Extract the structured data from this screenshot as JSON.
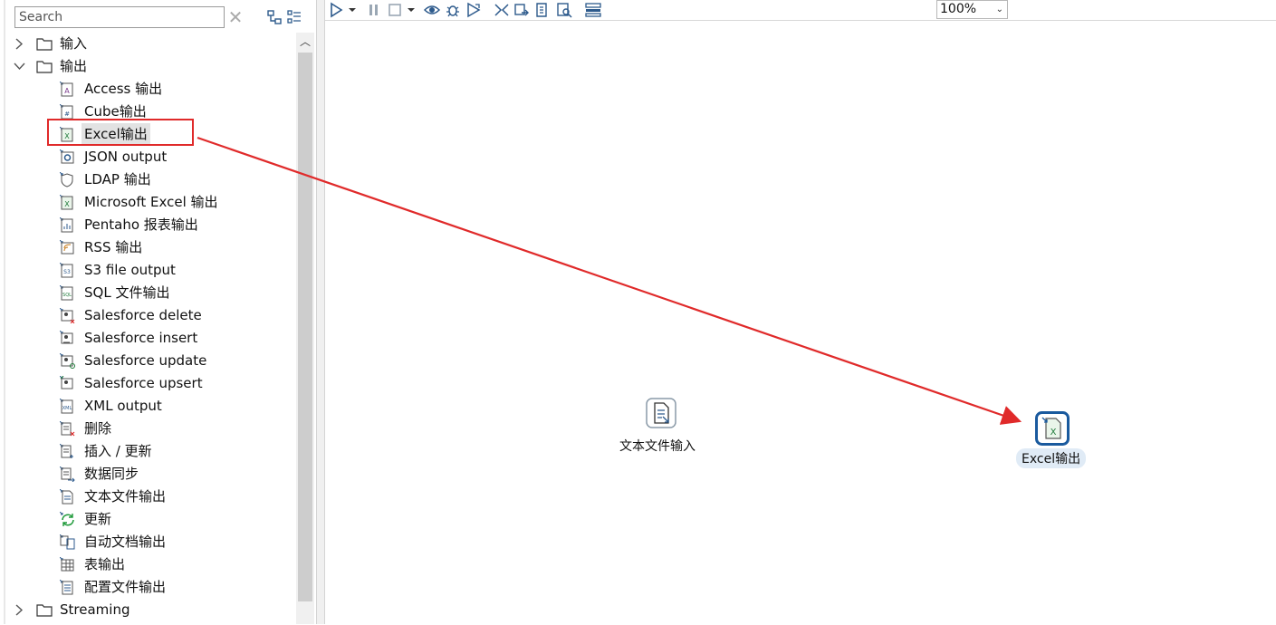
{
  "search": {
    "placeholder": "Search",
    "value": ""
  },
  "tree": {
    "categories": [
      {
        "label": "输入",
        "expanded": false
      },
      {
        "label": "输出",
        "expanded": true
      },
      {
        "label": "Streaming",
        "expanded": false
      }
    ],
    "items": [
      {
        "label": "Access 输出",
        "icon": "access-icon"
      },
      {
        "label": "Cube输出",
        "icon": "cube-icon"
      },
      {
        "label": "Excel输出",
        "icon": "excel-icon",
        "selected": true
      },
      {
        "label": "JSON output",
        "icon": "json-icon"
      },
      {
        "label": "LDAP 输出",
        "icon": "ldap-icon"
      },
      {
        "label": "Microsoft Excel 输出",
        "icon": "excel-icon"
      },
      {
        "label": "Pentaho 报表输出",
        "icon": "report-icon"
      },
      {
        "label": "RSS 输出",
        "icon": "rss-icon"
      },
      {
        "label": "S3 file output",
        "icon": "s3-icon"
      },
      {
        "label": "SQL 文件输出",
        "icon": "sql-icon"
      },
      {
        "label": "Salesforce delete",
        "icon": "salesforce-delete-icon"
      },
      {
        "label": "Salesforce insert",
        "icon": "salesforce-insert-icon"
      },
      {
        "label": "Salesforce update",
        "icon": "salesforce-update-icon"
      },
      {
        "label": "Salesforce upsert",
        "icon": "salesforce-upsert-icon"
      },
      {
        "label": "XML output",
        "icon": "xml-icon"
      },
      {
        "label": "删除",
        "icon": "delete-icon"
      },
      {
        "label": "插入 / 更新",
        "icon": "insert-update-icon"
      },
      {
        "label": "数据同步",
        "icon": "sync-icon"
      },
      {
        "label": "文本文件输出",
        "icon": "text-file-icon"
      },
      {
        "label": "更新",
        "icon": "update-icon"
      },
      {
        "label": "自动文档输出",
        "icon": "autodoc-icon"
      },
      {
        "label": "表输出",
        "icon": "table-icon"
      },
      {
        "label": "配置文件输出",
        "icon": "properties-icon"
      }
    ]
  },
  "toolbar": {
    "zoom": "100%",
    "zoom_dropdown": "⌄",
    "clear": "✕"
  },
  "canvas": {
    "steps": [
      {
        "label": "文本文件输入",
        "icon": "text-file-input-icon"
      },
      {
        "label": "Excel输出",
        "icon": "excel-output-icon"
      }
    ]
  },
  "colors": {
    "annotation": "#e02a2a",
    "accent": "#1a5a9e"
  }
}
